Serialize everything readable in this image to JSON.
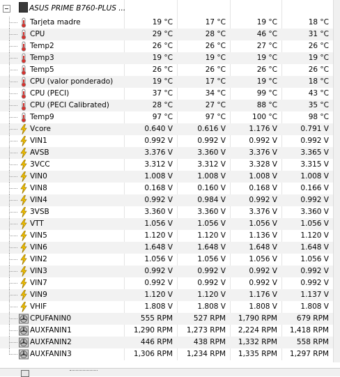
{
  "device": {
    "title": "ASUS PRIME B760-PLUS ..."
  },
  "icon_names": {
    "temperature": "thermometer-icon",
    "voltage": "lightning-bolt-icon",
    "fan": "fan-icon",
    "device": "motherboard-chip-icon"
  },
  "rows": [
    {
      "label": "Tarjeta madre",
      "type": "temp",
      "values": [
        "19 °C",
        "17 °C",
        "19 °C",
        "18 °C"
      ]
    },
    {
      "label": "CPU",
      "type": "temp",
      "values": [
        "29 °C",
        "28 °C",
        "46 °C",
        "31 °C"
      ]
    },
    {
      "label": "Temp2",
      "type": "temp",
      "values": [
        "26 °C",
        "26 °C",
        "27 °C",
        "26 °C"
      ]
    },
    {
      "label": "Temp3",
      "type": "temp",
      "values": [
        "19 °C",
        "19 °C",
        "19 °C",
        "19 °C"
      ]
    },
    {
      "label": "Temp5",
      "type": "temp",
      "values": [
        "26 °C",
        "26 °C",
        "26 °C",
        "26 °C"
      ]
    },
    {
      "label": "CPU (valor ponderado)",
      "type": "temp",
      "values": [
        "19 °C",
        "17 °C",
        "19 °C",
        "18 °C"
      ]
    },
    {
      "label": "CPU (PECI)",
      "type": "temp",
      "values": [
        "37 °C",
        "34 °C",
        "99 °C",
        "43 °C"
      ]
    },
    {
      "label": "CPU (PECI Calibrated)",
      "type": "temp",
      "values": [
        "28 °C",
        "27 °C",
        "88 °C",
        "35 °C"
      ]
    },
    {
      "label": "Temp9",
      "type": "temp",
      "values": [
        "97 °C",
        "97 °C",
        "100 °C",
        "98 °C"
      ]
    },
    {
      "label": "Vcore",
      "type": "volt",
      "values": [
        "0.640 V",
        "0.616 V",
        "1.176 V",
        "0.791 V"
      ]
    },
    {
      "label": "VIN1",
      "type": "volt",
      "values": [
        "0.992 V",
        "0.992 V",
        "0.992 V",
        "0.992 V"
      ]
    },
    {
      "label": "AVSB",
      "type": "volt",
      "values": [
        "3.376 V",
        "3.360 V",
        "3.376 V",
        "3.365 V"
      ]
    },
    {
      "label": "3VCC",
      "type": "volt",
      "values": [
        "3.312 V",
        "3.312 V",
        "3.328 V",
        "3.315 V"
      ]
    },
    {
      "label": "VIN0",
      "type": "volt",
      "values": [
        "1.008 V",
        "1.008 V",
        "1.008 V",
        "1.008 V"
      ]
    },
    {
      "label": "VIN8",
      "type": "volt",
      "values": [
        "0.168 V",
        "0.160 V",
        "0.168 V",
        "0.166 V"
      ]
    },
    {
      "label": "VIN4",
      "type": "volt",
      "values": [
        "0.992 V",
        "0.984 V",
        "0.992 V",
        "0.992 V"
      ]
    },
    {
      "label": "3VSB",
      "type": "volt",
      "values": [
        "3.360 V",
        "3.360 V",
        "3.376 V",
        "3.360 V"
      ]
    },
    {
      "label": "VTT",
      "type": "volt",
      "values": [
        "1.056 V",
        "1.056 V",
        "1.056 V",
        "1.056 V"
      ]
    },
    {
      "label": "VIN5",
      "type": "volt",
      "values": [
        "1.120 V",
        "1.120 V",
        "1.136 V",
        "1.120 V"
      ]
    },
    {
      "label": "VIN6",
      "type": "volt",
      "values": [
        "1.648 V",
        "1.648 V",
        "1.648 V",
        "1.648 V"
      ]
    },
    {
      "label": "VIN2",
      "type": "volt",
      "values": [
        "1.056 V",
        "1.056 V",
        "1.056 V",
        "1.056 V"
      ]
    },
    {
      "label": "VIN3",
      "type": "volt",
      "values": [
        "0.992 V",
        "0.992 V",
        "0.992 V",
        "0.992 V"
      ]
    },
    {
      "label": "VIN7",
      "type": "volt",
      "values": [
        "0.992 V",
        "0.992 V",
        "0.992 V",
        "0.992 V"
      ]
    },
    {
      "label": "VIN9",
      "type": "volt",
      "values": [
        "1.120 V",
        "1.120 V",
        "1.176 V",
        "1.137 V"
      ]
    },
    {
      "label": "VHIF",
      "type": "volt",
      "values": [
        "1.808 V",
        "1.808 V",
        "1.808 V",
        "1.808 V"
      ]
    },
    {
      "label": "CPUFANIN0",
      "type": "fan",
      "values": [
        "555 RPM",
        "527 RPM",
        "1,790 RPM",
        "679 RPM"
      ]
    },
    {
      "label": "AUXFANIN1",
      "type": "fan",
      "values": [
        "1,290 RPM",
        "1,273 RPM",
        "2,224 RPM",
        "1,418 RPM"
      ]
    },
    {
      "label": "AUXFANIN2",
      "type": "fan",
      "values": [
        "446 RPM",
        "438 RPM",
        "1,332 RPM",
        "558 RPM"
      ]
    },
    {
      "label": "AUXFANIN3",
      "type": "fan",
      "values": [
        "1,306 RPM",
        "1,234 RPM",
        "1,335 RPM",
        "1,297 RPM"
      ]
    }
  ],
  "colors": {
    "thermo_red": "#d9302c",
    "bolt_yellow": "#f5c400",
    "row_alt": "#f2f2f2"
  }
}
